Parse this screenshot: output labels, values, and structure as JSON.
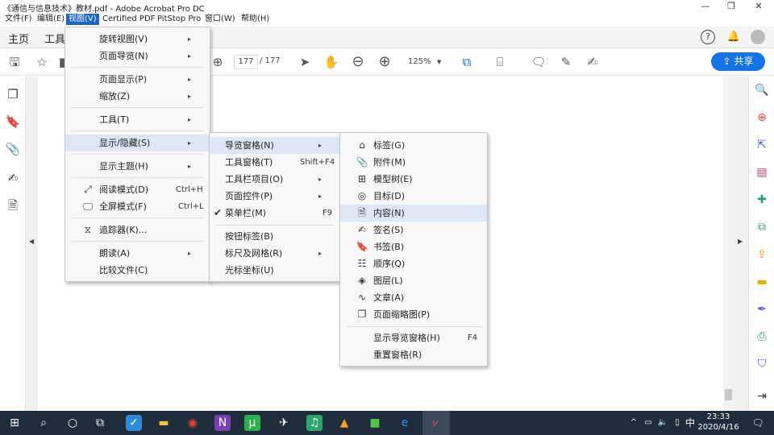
{
  "window": {
    "title": "《通信与信息技术》教材.pdf - Adobe Acrobat Pro DC",
    "minimize": "—",
    "restore": "❐",
    "close": "✕"
  },
  "menubar": [
    "文件(F)",
    "编辑(E)",
    "视图(V)",
    "Certified PDF",
    "PitStop Pro",
    "窗口(W)",
    "帮助(H)"
  ],
  "tabs": {
    "home": "主页",
    "tools": "工具"
  },
  "toolbar": {
    "page_current": "177",
    "page_total": "/ 177",
    "zoom": "125%",
    "share": "共享"
  },
  "view_menu": [
    {
      "label": "旋转视图(V)",
      "arrow": "▸"
    },
    {
      "label": "页面导览(N)",
      "arrow": "▸"
    },
    {
      "label": "页面显示(P)",
      "arrow": "▸"
    },
    {
      "label": "缩放(Z)",
      "arrow": "▸"
    },
    {
      "label": "工具(T)",
      "arrow": "▸"
    },
    {
      "label": "显示/隐藏(S)",
      "arrow": "▸"
    },
    {
      "label": "显示主题(H)",
      "arrow": "▸"
    },
    {
      "label": "阅读模式(D)",
      "shortcut": "Ctrl+H"
    },
    {
      "label": "全屏模式(F)",
      "shortcut": "Ctrl+L"
    },
    {
      "label": "追踪器(K)..."
    },
    {
      "label": "朗读(A)",
      "arrow": "▸"
    },
    {
      "label": "比较文件(C)"
    }
  ],
  "showhide_menu": [
    {
      "label": "导览窗格(N)",
      "arrow": "▸"
    },
    {
      "label": "工具窗格(T)",
      "shortcut": "Shift+F4"
    },
    {
      "label": "工具栏项目(O)",
      "arrow": "▸"
    },
    {
      "label": "页面控件(P)",
      "arrow": "▸"
    },
    {
      "label": "菜单栏(M)",
      "shortcut": "F9",
      "check": "✔"
    },
    {
      "label": "按钮标签(B)"
    },
    {
      "label": "标尺及网格(R)",
      "arrow": "▸"
    },
    {
      "label": "光标坐标(U)"
    }
  ],
  "nav_menu": [
    {
      "label": "标签(G)"
    },
    {
      "label": "附件(M)"
    },
    {
      "label": "模型树(E)"
    },
    {
      "label": "目标(D)"
    },
    {
      "label": "内容(N)"
    },
    {
      "label": "签名(S)"
    },
    {
      "label": "书签(B)"
    },
    {
      "label": "顺序(Q)"
    },
    {
      "label": "图层(L)"
    },
    {
      "label": "文章(A)"
    },
    {
      "label": "页面缩略图(P)"
    },
    {
      "label": "显示导览窗格(H)",
      "shortcut": "F4"
    },
    {
      "label": "重置窗格(R)"
    }
  ],
  "taskbar": {
    "time": "23:33",
    "date": "2020/4/16",
    "ime": "中"
  },
  "colors": {
    "accent": "#1473e6",
    "menu_highlight": "#dce6f4",
    "taskbar": "#1f2c3c"
  }
}
